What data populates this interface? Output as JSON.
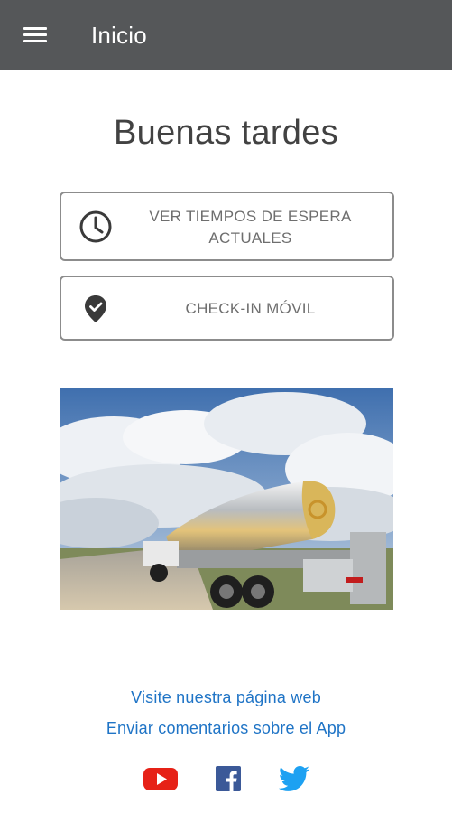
{
  "app_bar": {
    "title": "Inicio",
    "menu_icon": "hamburger-menu-icon",
    "background": "#555759"
  },
  "greeting": "Buenas tardes",
  "actions": {
    "wait_times": {
      "label": "VER TIEMPOS DE ESPERA ACTUALES",
      "icon": "clock-icon"
    },
    "checkin": {
      "label": "CHECK-IN MÓVIL",
      "icon": "location-check-icon"
    }
  },
  "hero_image": {
    "subject": "tanker-truck-photo"
  },
  "links": {
    "website": "Visite nuestra página web",
    "feedback": "Enviar comentarios sobre el App",
    "color": "#1f74c6"
  },
  "social": [
    {
      "icon": "youtube-icon",
      "color": "#e62117"
    },
    {
      "icon": "facebook-icon",
      "color": "#3b5998"
    },
    {
      "icon": "twitter-icon",
      "color": "#1da1f2"
    }
  ]
}
